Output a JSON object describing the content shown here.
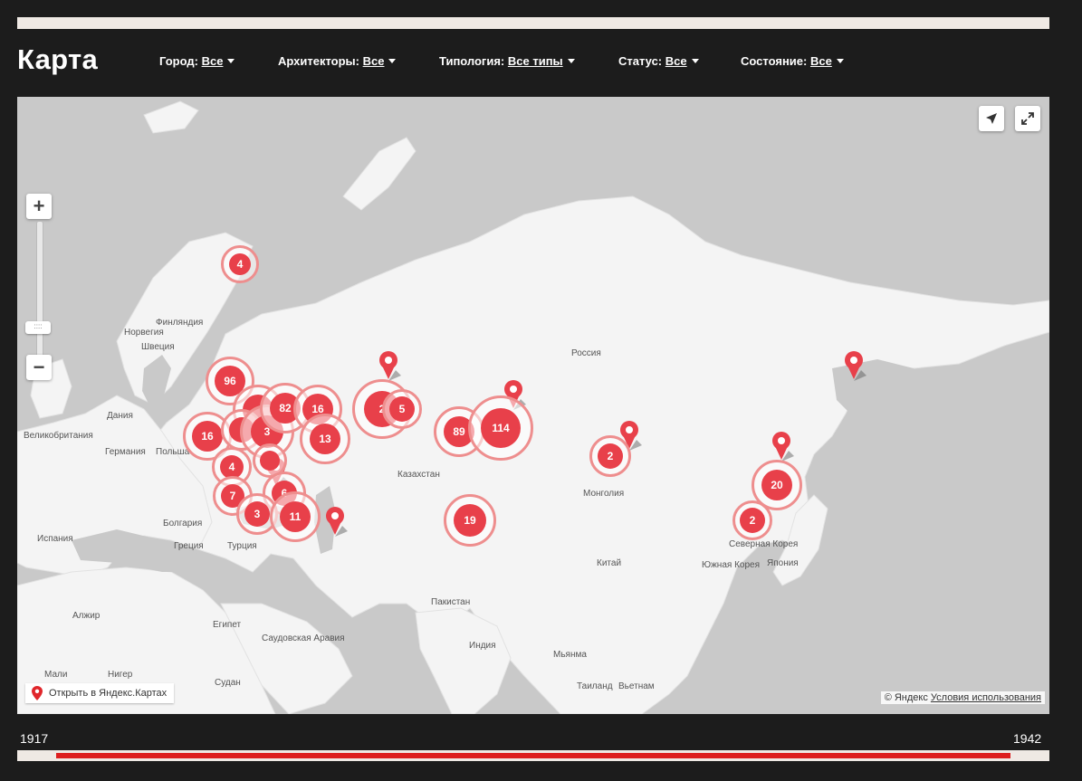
{
  "header": {
    "title": "Карта",
    "filters": [
      {
        "label": "Город:",
        "value": "Все"
      },
      {
        "label": "Архитекторы:",
        "value": "Все"
      },
      {
        "label": "Типология:",
        "value": "Все типы"
      },
      {
        "label": "Статус:",
        "value": "Все"
      },
      {
        "label": "Состояние:",
        "value": "Все"
      }
    ]
  },
  "map": {
    "labels": {
      "finland": "Финляндия",
      "norway": "Норвегия",
      "sweden": "Швеция",
      "denmark": "Дания",
      "uk": "Великобритания",
      "germany": "Германия",
      "poland": "Польша",
      "bulgaria": "Болгария",
      "spain": "Испания",
      "greece": "Греция",
      "turkey": "Турция",
      "russia": "Россия",
      "kazakhstan": "Казахстан",
      "mongolia": "Монголия",
      "china": "Китай",
      "north_korea": "Северная Корея",
      "south_korea": "Южная Корея",
      "japan": "Япония",
      "pakistan": "Пакистан",
      "india": "Индия",
      "myanmar": "Мьянма",
      "thailand": "Таиланд",
      "vietnam": "Вьетнам",
      "algeria": "Алжир",
      "egypt": "Египет",
      "saudi": "Саудовская Аравия",
      "mali": "Мали",
      "niger": "Нигер",
      "sudan": "Судан"
    },
    "clusters": [
      "4",
      "96",
      "82",
      "16",
      "3",
      "16",
      "13",
      "2",
      "5",
      "89",
      "114",
      "4",
      "6",
      "7",
      "3",
      "11",
      "19",
      "2",
      "20",
      "2"
    ],
    "open_link": "Открыть в Яндекс.Картах",
    "copyright": "© Яндекс",
    "terms": "Условия использования",
    "zoom_in": "+",
    "zoom_out": "−"
  },
  "timeline": {
    "start_year": "1917",
    "end_year": "1942"
  },
  "colors": {
    "accent": "#e8404a",
    "slider_range": "#dd1f1f",
    "background": "#1c1c1c"
  }
}
